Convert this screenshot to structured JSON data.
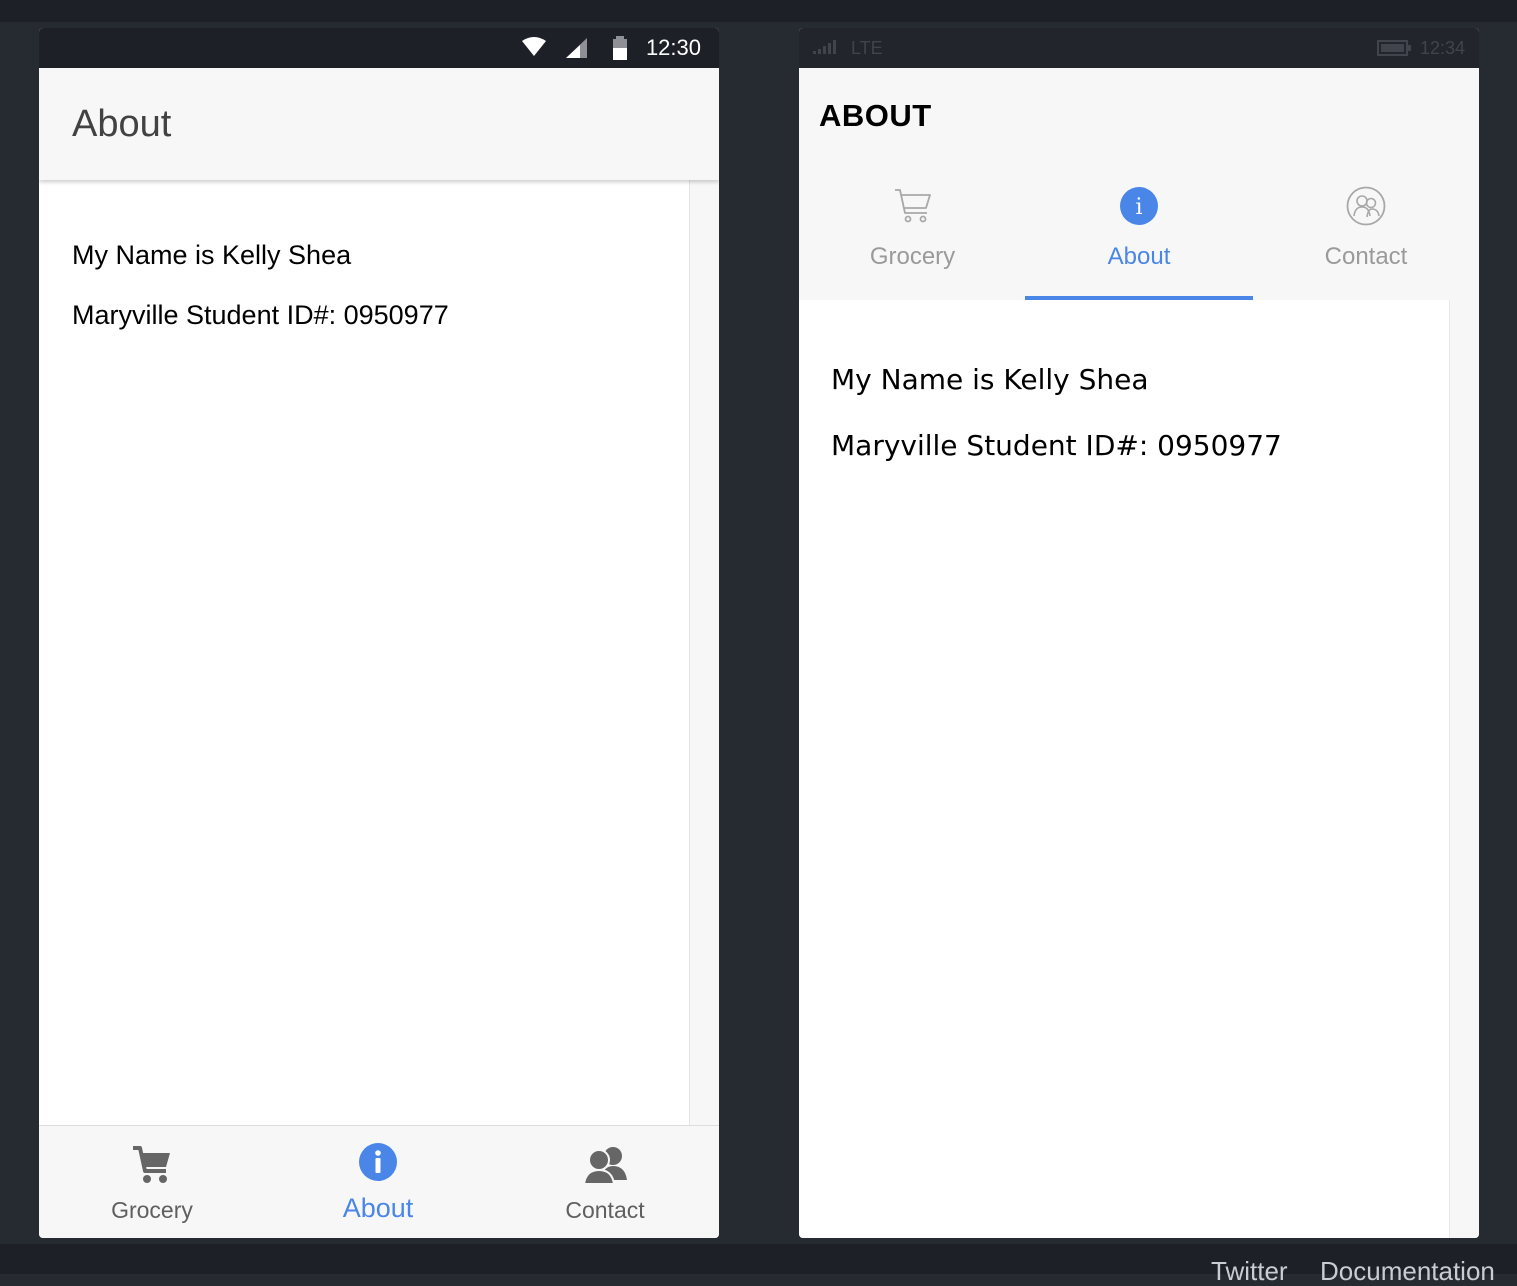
{
  "footer": {
    "links": [
      "Twitter",
      "Documentation"
    ]
  },
  "android": {
    "status": {
      "time": "12:30"
    },
    "toolbar": {
      "title": "About"
    },
    "content": {
      "name_line": "My Name is Kelly Shea",
      "id_line": "Maryville Student ID#: 0950977"
    },
    "tabs": [
      {
        "label": "Grocery",
        "icon": "cart-icon",
        "active": false
      },
      {
        "label": "About",
        "icon": "info-icon",
        "active": true
      },
      {
        "label": "Contact",
        "icon": "contacts-icon",
        "active": false
      }
    ]
  },
  "ios": {
    "status": {
      "carrier": "LTE",
      "time": "12:34"
    },
    "header": {
      "title": "ABOUT"
    },
    "tabs": [
      {
        "label": "Grocery",
        "icon": "cart-outline-icon",
        "active": false
      },
      {
        "label": "About",
        "icon": "info-icon",
        "active": true
      },
      {
        "label": "Contact",
        "icon": "contacts-outline-icon",
        "active": false
      }
    ],
    "content": {
      "name_line": "My Name is Kelly Shea",
      "id_line": "Maryville Student ID#: 0950977"
    }
  },
  "colors": {
    "accent": "#4a86e8",
    "background": "#262a31",
    "toolbar": "#f7f7f7",
    "inactive_tab": "#5f5f5f"
  }
}
